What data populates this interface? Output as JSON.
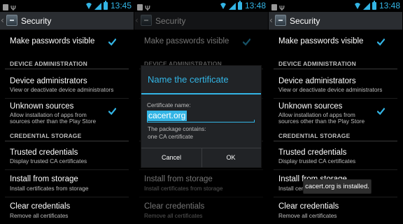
{
  "status_bar": {
    "time_1": "13:45",
    "time_2": "13:48",
    "time_3": "13:48"
  },
  "action_bar": {
    "title": "Security"
  },
  "settings": {
    "make_passwords_visible": {
      "title": "Make passwords visible",
      "checked": true
    },
    "device_administration_header": "DEVICE ADMINISTRATION",
    "device_administrators": {
      "title": "Device administrators",
      "summary": "View or deactivate device administrators"
    },
    "unknown_sources": {
      "title": "Unknown sources",
      "summary_line1": "Allow installation of apps from",
      "summary_line2": "sources other than the Play Store",
      "checked": true
    },
    "credential_storage_header": "CREDENTIAL STORAGE",
    "trusted_credentials": {
      "title": "Trusted credentials",
      "summary": "Display trusted CA certificates"
    },
    "install_from_storage": {
      "title": "Install from storage",
      "summary": "Install certificates from storage"
    },
    "clear_credentials": {
      "title": "Clear credentials",
      "summary": "Remove all certificates"
    }
  },
  "dialog": {
    "title": "Name the certificate",
    "field_label": "Certificate name:",
    "field_value": "cacert.org",
    "info_line1": "The package contains:",
    "info_line2": "one CA certificate",
    "cancel_label": "Cancel",
    "ok_label": "OK"
  },
  "toast": {
    "message": "cacert.org is installed."
  },
  "colors": {
    "accent": "#33b5e5",
    "action_bar": "#2a2d31",
    "background": "#000000",
    "secondary_text": "#bdbdbd"
  },
  "icons": [
    "back-arrow-icon",
    "security-settings-icon",
    "usb-icon",
    "wifi-icon",
    "signal-icon",
    "battery-icon",
    "checkbox-checked-icon"
  ]
}
